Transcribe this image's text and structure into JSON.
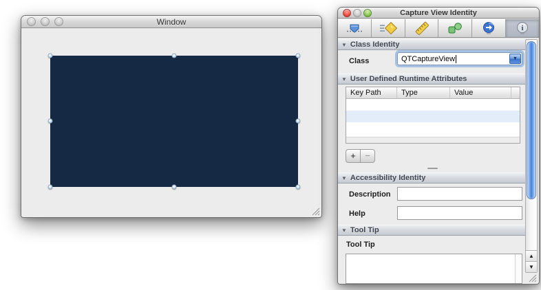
{
  "design_window": {
    "title": "Window",
    "capture_view_color": "#152844",
    "traffic_lights": [
      "close",
      "minimize",
      "zoom"
    ]
  },
  "inspector": {
    "title": "Capture View Identity",
    "disclosure_triangle": "▼",
    "dropdown_triangle": "▼",
    "scroll_up_glyph": "▲",
    "scroll_down_glyph": "▼",
    "toolbar": {
      "items": [
        {
          "name": "attributes-inspector"
        },
        {
          "name": "effects-inspector"
        },
        {
          "name": "size-inspector"
        },
        {
          "name": "bindings-inspector"
        },
        {
          "name": "connections-inspector"
        },
        {
          "name": "identity-inspector",
          "selected": true
        }
      ]
    },
    "class_section": {
      "header": "Class Identity",
      "class_label": "Class",
      "class_value": "QTCaptureView"
    },
    "runtime_section": {
      "header": "User Defined Runtime Attributes",
      "columns": [
        "Key Path",
        "Type",
        "Value"
      ],
      "rows": [],
      "add_label": "+",
      "remove_label": "−"
    },
    "accessibility_section": {
      "header": "Accessibility Identity",
      "description_label": "Description",
      "description_value": "",
      "help_label": "Help",
      "help_value": ""
    },
    "tooltip_section": {
      "header": "Tool Tip",
      "field_label": "Tool Tip",
      "value": ""
    }
  },
  "colors": {
    "capture_view": "#152844",
    "scrollbar_accent": "#4580da",
    "table_alt_row": "#e3edf9",
    "window_chrome": "#ececec"
  }
}
